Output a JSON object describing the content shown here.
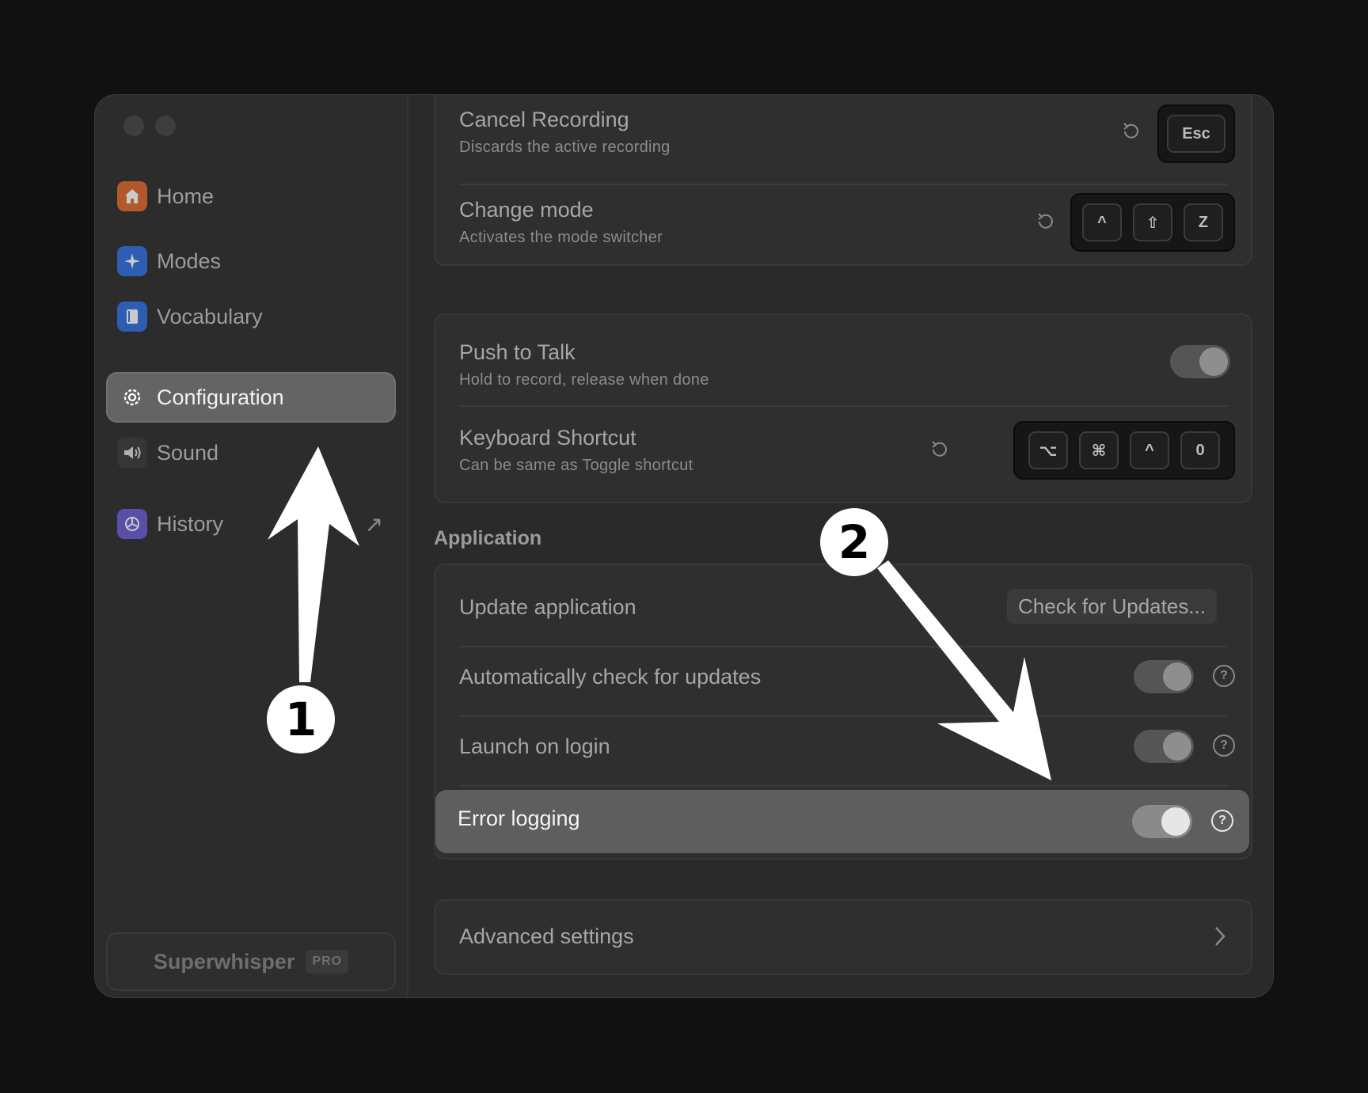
{
  "sidebar": {
    "items": [
      {
        "label": "Home",
        "icon": "house-icon",
        "color": "#e0672d"
      },
      {
        "label": "Modes",
        "icon": "sparkle-icon",
        "color": "#2f6fe0"
      },
      {
        "label": "Vocabulary",
        "icon": "book-icon",
        "color": "#2f6fe0"
      },
      {
        "label": "Configuration",
        "icon": "gear-icon",
        "color": "#ffffff"
      },
      {
        "label": "Sound",
        "icon": "speaker-icon",
        "color": "#8a8a8a"
      },
      {
        "label": "History",
        "icon": "history-icon",
        "color": "#6a5ad6"
      }
    ],
    "active_item": "Configuration",
    "brand": {
      "name": "Superwhisper",
      "badge": "PRO"
    }
  },
  "shortcuts": {
    "cancel_recording": {
      "title": "Cancel Recording",
      "subtitle": "Discards the active recording",
      "keys": [
        "Esc"
      ]
    },
    "change_mode": {
      "title": "Change mode",
      "subtitle": "Activates the mode switcher",
      "keys": [
        "^",
        "⇧",
        "Z"
      ]
    }
  },
  "push_to_talk": {
    "toggle": {
      "title": "Push to Talk",
      "subtitle": "Hold to record, release when done",
      "enabled": false
    },
    "keyboard_shortcut": {
      "title": "Keyboard Shortcut",
      "subtitle": "Can be same as Toggle shortcut",
      "keys": [
        "⌥",
        "⌘",
        "^",
        "0"
      ]
    }
  },
  "application": {
    "section_title": "Application",
    "update": {
      "title": "Update application",
      "button": "Check for Updates..."
    },
    "auto_check": {
      "title": "Automatically check for updates",
      "enabled": false
    },
    "launch_on_login": {
      "title": "Launch on login",
      "enabled": false
    },
    "error_logging": {
      "title": "Error logging",
      "enabled": false
    }
  },
  "advanced": {
    "title": "Advanced settings"
  },
  "annotations": [
    "1",
    "2"
  ]
}
